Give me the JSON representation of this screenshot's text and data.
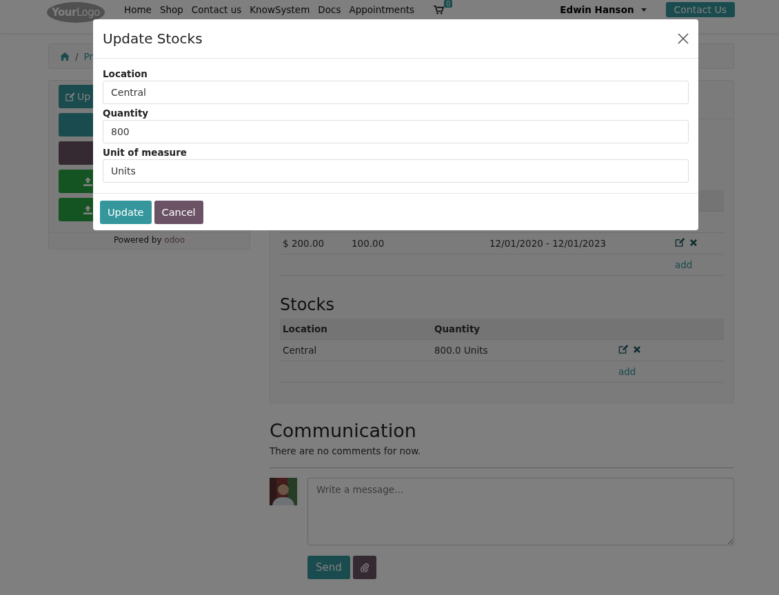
{
  "navbar": {
    "logo": "**Your**Logo",
    "links": [
      "Home",
      "Shop",
      "Contact us",
      "KnowSystem",
      "Docs",
      "Appointments"
    ],
    "cart_count": "0",
    "user": "Edwin Hanson",
    "cta": "Contact Us"
  },
  "breadcrumb": {
    "separator": "/",
    "current": "Pr"
  },
  "sidebar": {
    "buttons": [
      {
        "kind": "edit",
        "label": "Up"
      },
      {
        "kind": "primary"
      },
      {
        "kind": "secondary"
      },
      {
        "kind": "upload"
      },
      {
        "kind": "upload"
      }
    ],
    "powered_by": "Powered by",
    "brand": "odoo"
  },
  "pricing_table": {
    "rows": [
      {
        "price": "$ 200.00",
        "quantity": "100.00",
        "period": "12/01/2020 - 12/01/2023"
      }
    ],
    "add_link": "add"
  },
  "stocks": {
    "title": "Stocks",
    "columns": [
      "Location",
      "Quantity"
    ],
    "rows": [
      {
        "location": "Central",
        "quantity": "800.0 Units"
      }
    ],
    "add_link": "add"
  },
  "communication": {
    "title": "Communication",
    "empty_text": "There are no comments for now.",
    "placeholder": "Write a message...",
    "send": "Send"
  },
  "modal": {
    "title": "Update Stocks",
    "fields": [
      {
        "label": "Location",
        "value": "Central"
      },
      {
        "label": "Quantity",
        "value": "800"
      },
      {
        "label": "Unit of measure",
        "value": "Units"
      }
    ],
    "buttons": [
      {
        "kind": "primary",
        "label": "Update"
      },
      {
        "kind": "secondary",
        "label": "Cancel"
      }
    ]
  }
}
